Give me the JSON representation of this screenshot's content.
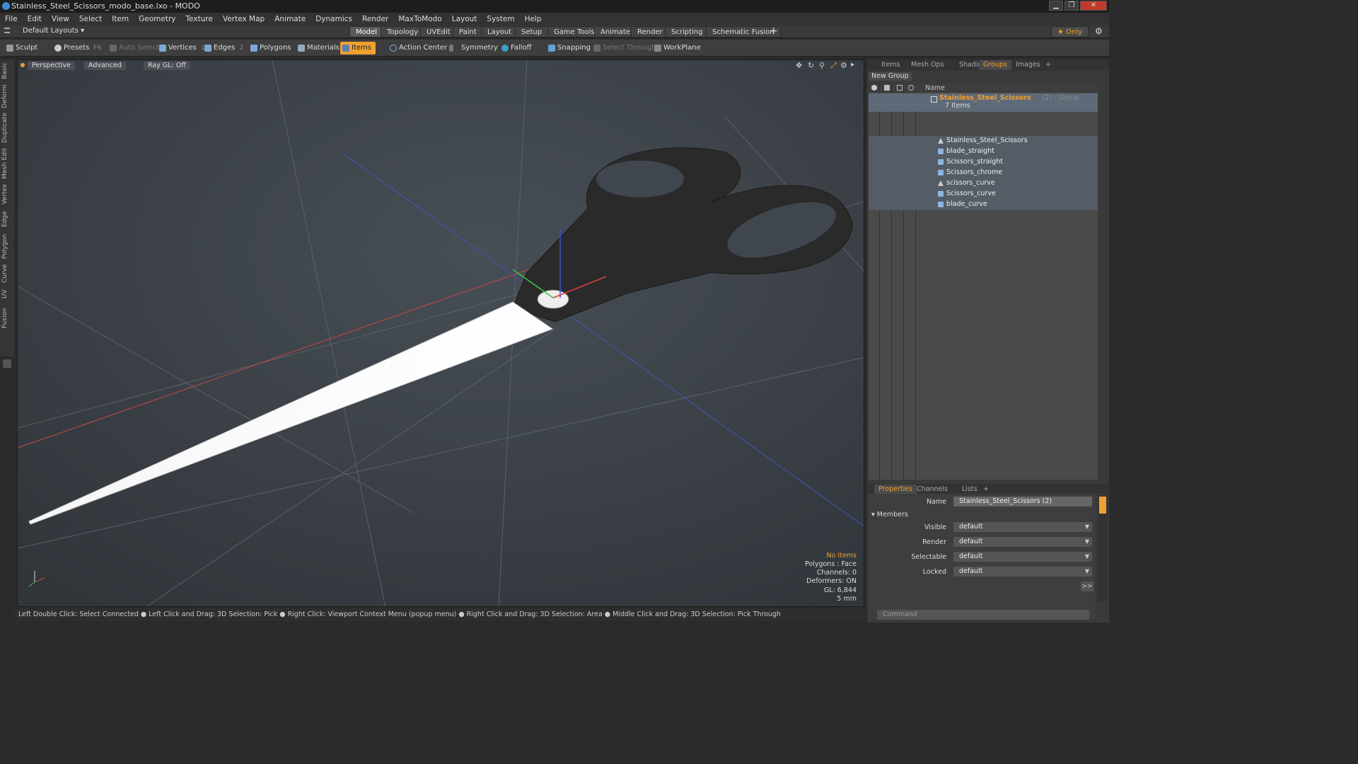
{
  "window": {
    "title": "Stainless_Steel_Scissors_modo_base.lxo - MODO",
    "min": "▁",
    "max": "❐",
    "close": "✕"
  },
  "menu": [
    "File",
    "Edit",
    "View",
    "Select",
    "Item",
    "Geometry",
    "Texture",
    "Vertex Map",
    "Animate",
    "Dynamics",
    "Render",
    "MaxToModo",
    "Layout",
    "System",
    "Help"
  ],
  "layoutbar": {
    "layouts_label": "Default Layouts ▾",
    "tabs": [
      "Model",
      "Topology",
      "UVEdit",
      "Paint",
      "Layout",
      "Setup",
      "Game Tools",
      "Animate",
      "Render",
      "Scripting",
      "Schematic Fusion"
    ],
    "plus": "+",
    "only_label": "★  Only",
    "settings": "⚙"
  },
  "toolbar": {
    "sculpt": "Sculpt",
    "presets": "Presets",
    "presets_key": "F6",
    "auto_select": "Auto Select",
    "vertices": "Vertices",
    "vertices_key": "1",
    "edges": "Edges",
    "edges_key": "2",
    "polygons": "Polygons",
    "materials": "Materials",
    "items": "Items",
    "action_center": "Action Center",
    "symmetry": "Symmetry",
    "falloff": "Falloff",
    "snapping": "Snapping",
    "select_through": "Select Through",
    "workplane": "WorkPlane"
  },
  "left_tabs": [
    "Basic",
    "Deform",
    "Duplicate",
    "Mesh Edit",
    "Vertex",
    "Edge",
    "Polygon",
    "Curve",
    "UV",
    "Fusion"
  ],
  "viewport": {
    "view_label": "Perspective",
    "advanced_label": "Advanced",
    "raygl_label": "Ray GL: Off",
    "info": {
      "no_items": "No Items",
      "polygons": "Polygons : Face",
      "channels": "Channels: 0",
      "deformers": "Deformers: ON",
      "gl": "GL: 6,844",
      "scale": "5 mm"
    }
  },
  "statusbar": "Left Double Click: Select Connected ● Left Click and Drag: 3D Selection: Pick ● Right Click: Viewport Context Menu (popup menu) ● Right Click and Drag: 3D Selection: Area ● Middle Click and Drag: 3D Selection: Pick Through",
  "panel": {
    "tabs": [
      "Items",
      "Mesh Ops",
      "Shading",
      "Groups",
      "Images",
      "+"
    ],
    "new_group": "New Group",
    "name_header": "Name",
    "group_name": "Stainless_Steel_Scissors",
    "group_suffix": "(2) : Group",
    "group_count": "7 Items",
    "items": [
      "Stainless_Steel_Scissors",
      "blade_straight",
      "Scissors_straight",
      "Scissors_chrome",
      "scissors_curve",
      "Scissors_curve",
      "blade_curve"
    ]
  },
  "properties": {
    "tabs": [
      "Properties",
      "Channels",
      "Lists",
      "+"
    ],
    "name_label": "Name",
    "name_value": "Stainless_Steel_Scissors (2)",
    "members_label": "Members",
    "fields": [
      {
        "label": "Visible",
        "value": "default"
      },
      {
        "label": "Render",
        "value": "default"
      },
      {
        "label": "Selectable",
        "value": "default"
      },
      {
        "label": "Locked",
        "value": "default"
      }
    ],
    "more": ">>",
    "command_placeholder": "Command"
  },
  "colors": {
    "accent": "#f0a030",
    "viewport_bg": "#3b4148",
    "selection": "#545c66"
  }
}
